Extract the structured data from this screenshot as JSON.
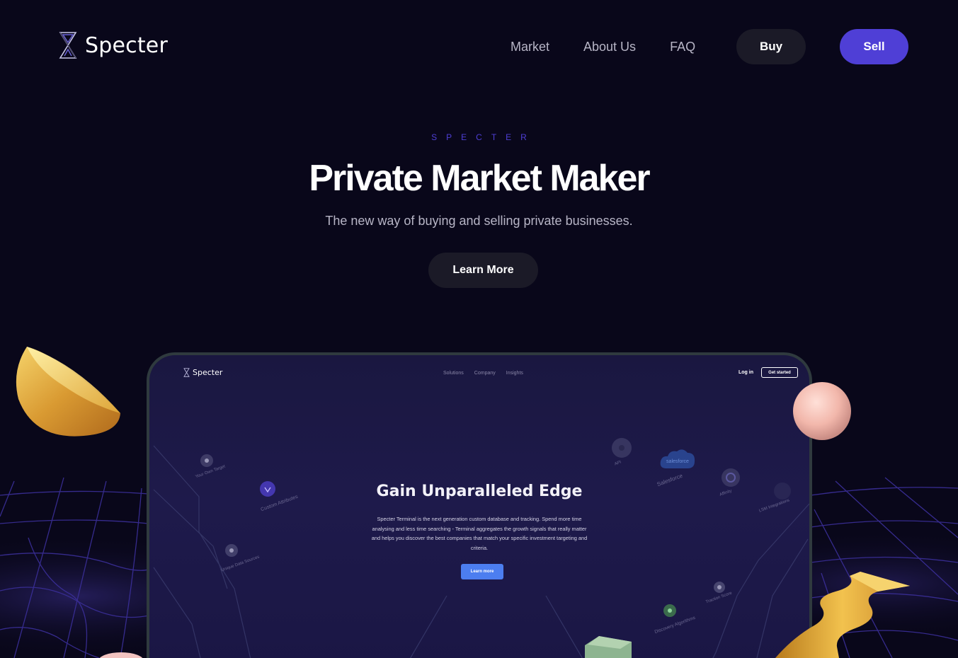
{
  "brand": {
    "name": "Specter"
  },
  "nav": {
    "links": [
      "Market",
      "About Us",
      "FAQ"
    ],
    "buy_label": "Buy",
    "sell_label": "Sell"
  },
  "hero": {
    "eyebrow": "SPECTER",
    "title": "Private Market Maker",
    "subtitle": "The new way of buying and selling private businesses.",
    "cta_label": "Learn More"
  },
  "mockup": {
    "brand": "Specter",
    "nav": [
      "Solutions",
      "Company",
      "Insights"
    ],
    "login_label": "Log in",
    "get_started_label": "Get started",
    "title": "Gain Unparalleled Edge",
    "body": "Specter Terminal is the next generation custom database and tracking. Spend more time analysing and less time searching - Terminal aggregates the growth signals that really matter and helps you discover the best companies that match your specific investment targeting and criteria.",
    "cta_label": "Learn more",
    "nodes": [
      "Your Own Target",
      "Custom Attributes",
      "Unique Data Sources",
      "API",
      "Salesforce",
      "Affinity",
      "LSM Integrations",
      "Traction Score",
      "Discovery Algorithms"
    ],
    "salesforce_logo_text": "salesforce"
  },
  "colors": {
    "background": "#09071a",
    "accent": "#4f3fd6",
    "dark_button": "#1b1a27",
    "muted_text": "#b7b5c6",
    "mockup_button": "#4c7ef0"
  },
  "icons": {
    "logo": "specter-hourglass-icon"
  }
}
